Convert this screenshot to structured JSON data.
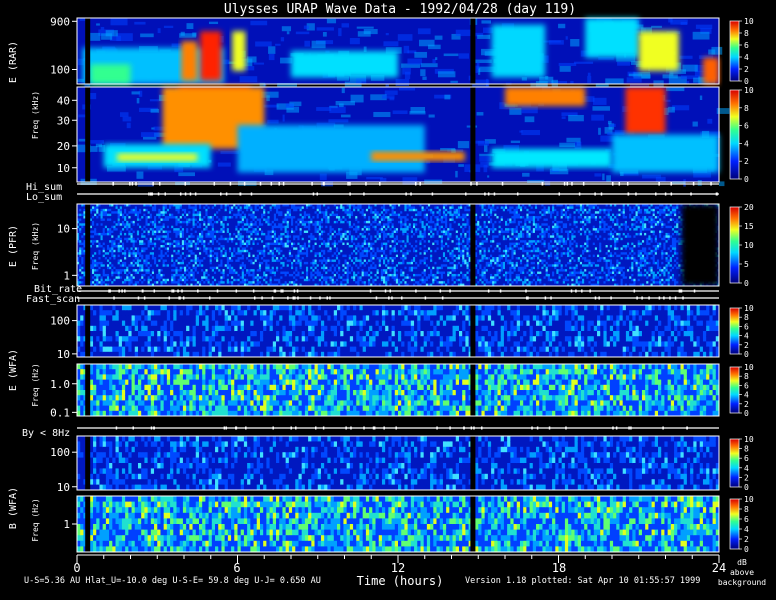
{
  "chart_data": {
    "type": "heatmap",
    "title": "Ulysses URAP Wave Data - 1992/04/28  (day 119)",
    "xlabel": "Time (hours)",
    "x_ticks": [
      "0",
      "6",
      "12",
      "18",
      "24"
    ],
    "xlim": [
      0,
      24
    ],
    "panels": [
      {
        "id": "rar-upper",
        "yticks": [
          "900",
          "100"
        ],
        "scale": "log",
        "cbar_ticks": [
          "10",
          "8",
          "6",
          "4",
          "2",
          "0"
        ]
      },
      {
        "id": "rar-lower",
        "yticks": [
          "40",
          "30",
          "20",
          "10"
        ],
        "scale": "linear",
        "cbar_ticks": [
          "10",
          "8",
          "6",
          "4",
          "2",
          "0"
        ]
      },
      {
        "id": "pfr",
        "yticks": [
          "10",
          "1"
        ],
        "scale": "log",
        "cbar_ticks": [
          "20",
          "15",
          "10",
          "5",
          "0"
        ]
      },
      {
        "id": "wfa-e-upper",
        "yticks": [
          "100",
          "10"
        ],
        "scale": "log",
        "cbar_ticks": [
          "10",
          "8",
          "6",
          "4",
          "2",
          "0"
        ]
      },
      {
        "id": "wfa-e-lower",
        "yticks": [
          "1.0",
          "0.1"
        ],
        "scale": "log",
        "cbar_ticks": [
          "10",
          "8",
          "6",
          "4",
          "2",
          "0"
        ]
      },
      {
        "id": "wfa-b-upper",
        "yticks": [
          "100",
          "10"
        ],
        "scale": "log",
        "cbar_ticks": [
          "10",
          "8",
          "6",
          "4",
          "2",
          "0"
        ]
      },
      {
        "id": "wfa-b-lower",
        "yticks": [
          "1"
        ],
        "scale": "log",
        "cbar_ticks": [
          "10",
          "8",
          "6",
          "4",
          "2",
          "0"
        ]
      }
    ],
    "group_labels": [
      "E  (RAR)",
      "E  (PFR)",
      "E  (WFA)",
      "B  (WFA)"
    ],
    "freq_label": "Freq (kHz)",
    "freq_label_hz": "Freq (Hz)",
    "flag_labels": [
      "Hi_sum",
      "Lo_sum",
      "Bit_rate",
      "Fast_scan",
      "By < 8Hz"
    ],
    "data_gap_hours": [
      0.4,
      14.8
    ],
    "colorbar_unit": [
      "dB",
      "above",
      "background"
    ],
    "footer_left": "U-S=5.36 AU   Hlat_U=-10.0 deg   U-S-E= 59.8 deg   U-J= 0.650 AU",
    "footer_right": "Version 1.18 plotted: Sat Apr 10 01:55:57 1999"
  }
}
